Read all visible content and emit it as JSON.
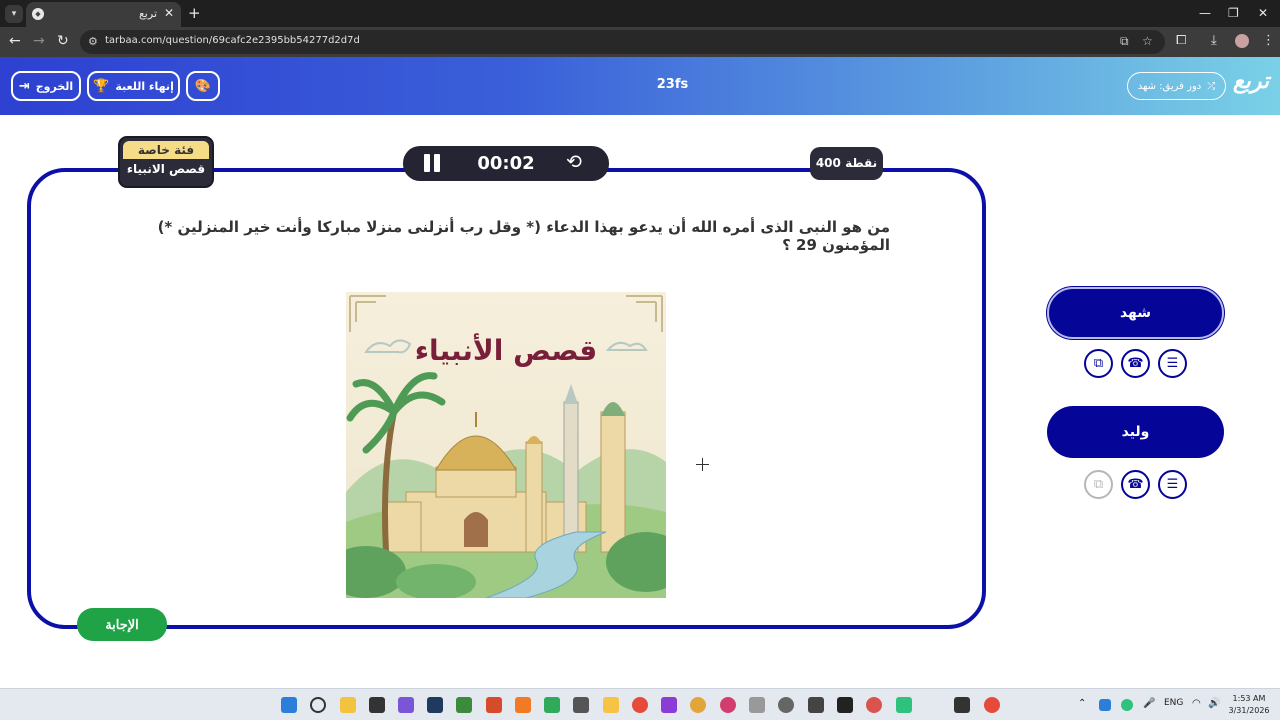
{
  "browser": {
    "tab_title": "تربع",
    "url": "tarbaa.com/question/69cafc2e2395bb54277d2d7d"
  },
  "header": {
    "logo_text": "تربع",
    "team_turn_label": "دور فريق: شهد",
    "game_name": "23fs",
    "end_game_label": "إنهاء اللعبة",
    "exit_label": "الخروج"
  },
  "question": {
    "text": "من هو النبى الذى أمره الله أن يدعو بهذا الدعاء (* وقل رب أنزلنى منزلا مباركا وأنت خير المنزلين *) المؤمنون 29 ؟",
    "category_type": "فئة خاصة",
    "category_name": "قصص الانبياء",
    "points": "400 نقطة",
    "timer": "00:02",
    "image_title": "قصص الأنبياء",
    "answer_label": "الإجابة"
  },
  "teams": [
    {
      "name": "شهد",
      "active": true
    },
    {
      "name": "وليد",
      "active": false
    }
  ],
  "taskbar": {
    "lang": "ENG",
    "time": "1:53 AM",
    "date": "3/31/2026"
  },
  "colors": {
    "card_border": "#0c10a8",
    "team_bg": "#050597",
    "answer_bg": "#20a347",
    "timer_bg": "#242432",
    "category_top": "#f6dc86"
  }
}
